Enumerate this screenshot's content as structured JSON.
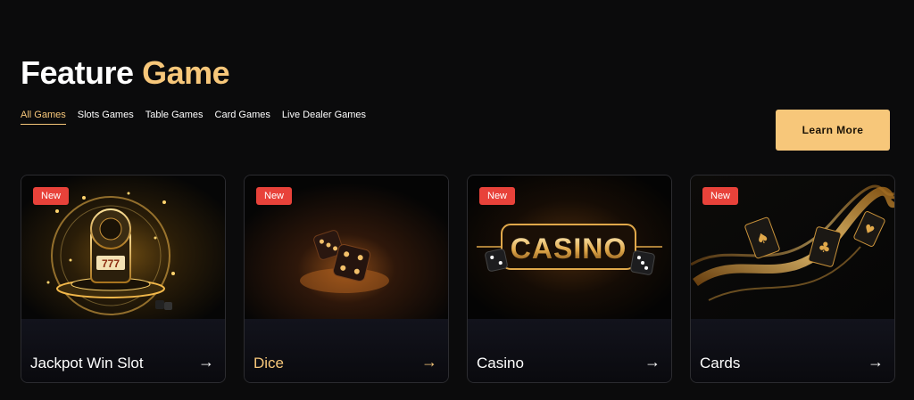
{
  "heading": {
    "part1": "Feature",
    "part2": "Game"
  },
  "tabs": [
    {
      "label": "All Games",
      "active": true
    },
    {
      "label": "Slots Games",
      "active": false
    },
    {
      "label": "Table Games",
      "active": false
    },
    {
      "label": "Card Games",
      "active": false
    },
    {
      "label": "Live Dealer Games",
      "active": false
    }
  ],
  "cta": {
    "label": "Learn More"
  },
  "cards": [
    {
      "badge": "New",
      "name": "Jackpot Win Slot",
      "highlighted": false,
      "image": "slot-machine-illustration"
    },
    {
      "badge": "New",
      "name": "Dice",
      "highlighted": true,
      "image": "dice-illustration"
    },
    {
      "badge": "New",
      "name": "Casino",
      "highlighted": false,
      "image": "casino-sign-illustration"
    },
    {
      "badge": "New",
      "name": "Cards",
      "highlighted": false,
      "image": "cards-illustration"
    }
  ],
  "icons": {
    "arrow": "arrow-right-icon"
  },
  "colors": {
    "accent": "#f7c77a",
    "badge": "#e8423a",
    "background": "#0b0b0c"
  }
}
